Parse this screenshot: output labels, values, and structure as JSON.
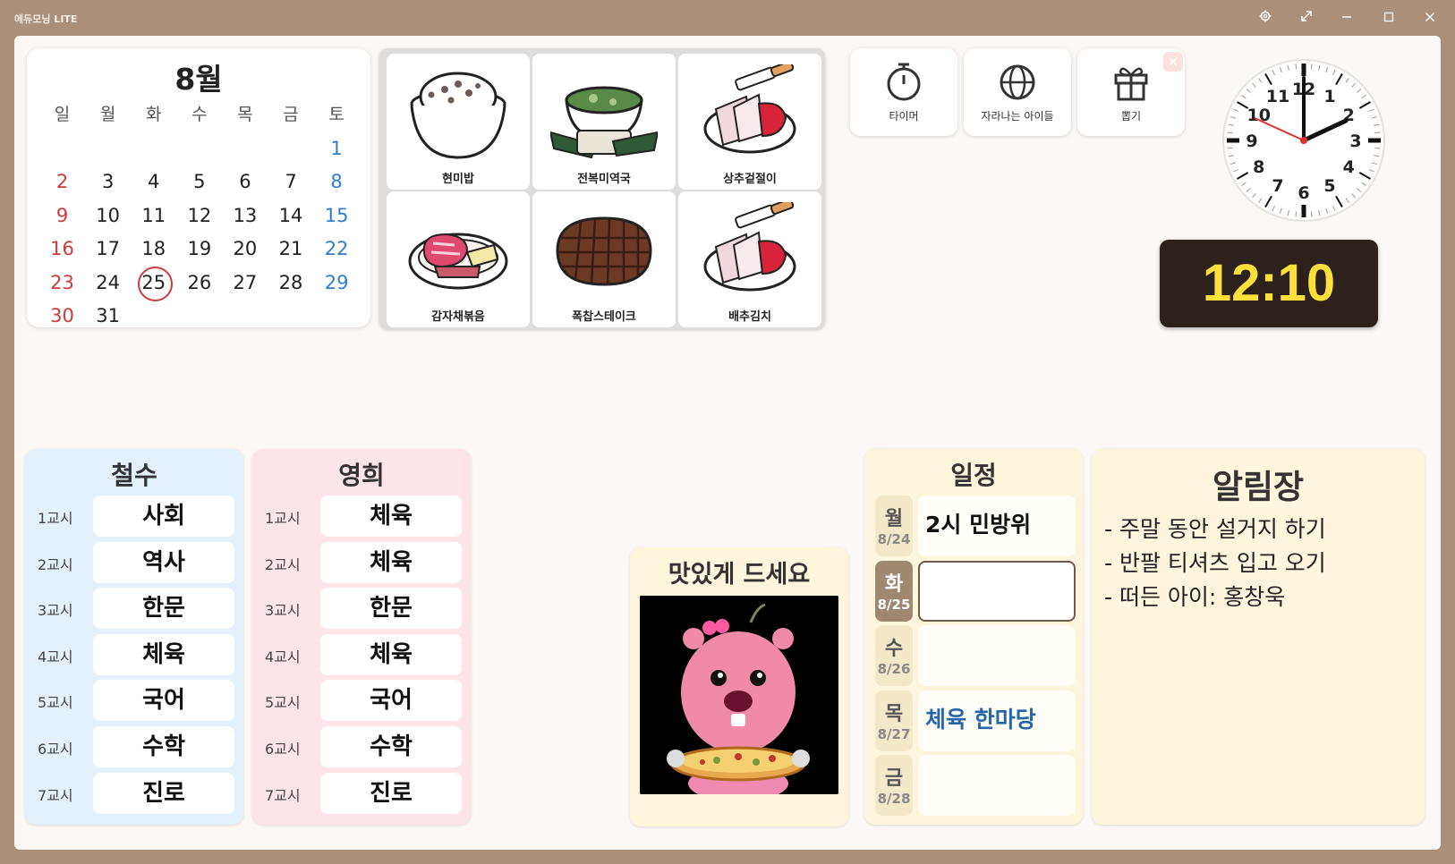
{
  "window": {
    "title": "에듀모닝 LITE"
  },
  "calendar": {
    "month": "8월",
    "weekdays": [
      "일",
      "월",
      "화",
      "수",
      "목",
      "금",
      "토"
    ],
    "weeks": [
      [
        "",
        "",
        "",
        "",
        "",
        "",
        "1"
      ],
      [
        "2",
        "3",
        "4",
        "5",
        "6",
        "7",
        "8"
      ],
      [
        "9",
        "10",
        "11",
        "12",
        "13",
        "14",
        "15"
      ],
      [
        "16",
        "17",
        "18",
        "19",
        "20",
        "21",
        "22"
      ],
      [
        "23",
        "24",
        "25",
        "26",
        "27",
        "28",
        "29"
      ],
      [
        "30",
        "31",
        "",
        "",
        "",
        "",
        ""
      ]
    ],
    "today": "25"
  },
  "menu": {
    "items": [
      {
        "label": "현미밥",
        "icon": "rice-bowl-icon"
      },
      {
        "label": "전복미역국",
        "icon": "seaweed-soup-icon"
      },
      {
        "label": "상추겉절이",
        "icon": "lettuce-salad-icon"
      },
      {
        "label": "감자채볶음",
        "icon": "stir-fry-icon"
      },
      {
        "label": "폭찹스테이크",
        "icon": "steak-icon"
      },
      {
        "label": "배추김치",
        "icon": "kimchi-icon"
      }
    ]
  },
  "tools": {
    "timer": "타이머",
    "growing": "자라나는 아이들",
    "draw": "뽑기"
  },
  "clock": {
    "digital": "12:10",
    "numbers": [
      "12",
      "1",
      "2",
      "3",
      "4",
      "5",
      "6",
      "7",
      "8",
      "9",
      "10",
      "11"
    ]
  },
  "timetable": {
    "left": {
      "name": "철수",
      "rows": [
        {
          "period": "1교시",
          "subject": "사회"
        },
        {
          "period": "2교시",
          "subject": "역사"
        },
        {
          "period": "3교시",
          "subject": "한문"
        },
        {
          "period": "4교시",
          "subject": "체육"
        },
        {
          "period": "5교시",
          "subject": "국어"
        },
        {
          "period": "6교시",
          "subject": "수학"
        },
        {
          "period": "7교시",
          "subject": "진로"
        }
      ]
    },
    "right": {
      "name": "영희",
      "rows": [
        {
          "period": "1교시",
          "subject": "체육"
        },
        {
          "period": "2교시",
          "subject": "체육"
        },
        {
          "period": "3교시",
          "subject": "한문"
        },
        {
          "period": "4교시",
          "subject": "체육"
        },
        {
          "period": "5교시",
          "subject": "국어"
        },
        {
          "period": "6교시",
          "subject": "수학"
        },
        {
          "period": "7교시",
          "subject": "진로"
        }
      ]
    }
  },
  "eat": {
    "title": "맛있게 드세요"
  },
  "schedule": {
    "title": "일정",
    "days": [
      {
        "day": "월",
        "date": "8/24",
        "note": "2시 민방위"
      },
      {
        "day": "화",
        "date": "8/25",
        "note": ""
      },
      {
        "day": "수",
        "date": "8/26",
        "note": ""
      },
      {
        "day": "목",
        "date": "8/27",
        "note": "체육 한마당"
      },
      {
        "day": "금",
        "date": "8/28",
        "note": ""
      }
    ]
  },
  "notice": {
    "title": "알림장",
    "lines": [
      "- 주말 동안 설거지 하기",
      "- 반팔 티셔츠 입고 오기",
      "- 떠든 아이: 홍창욱"
    ]
  }
}
